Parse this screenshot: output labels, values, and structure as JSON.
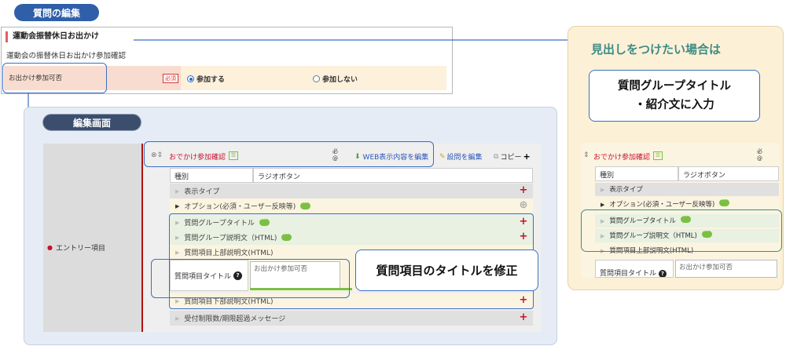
{
  "top_pill": "質問の編集",
  "preview": {
    "title": "運動会振替休日お出かけ",
    "subtitle": "運動会の振替休日お出かけ参加確認",
    "question_label": "お出かけ参加可否",
    "required_badge": "必須",
    "option_yes": "参加する",
    "option_no": "参加しない"
  },
  "edit_pill": "編集画面",
  "entry_label": "エントリー項目",
  "editor": {
    "question_name": "おでかけ参加確認",
    "at_badge_1": "必",
    "at_badge_2": "@",
    "web_edit": "WEB表示内容を編集",
    "setting_edit": "設問を編集",
    "copy": "コピー",
    "type_label": "種別",
    "type_value": "ラジオボタン",
    "rows": {
      "display_type": "表示タイプ",
      "options": "オプション(必須・ユーザー反映等)",
      "group_title": "質問グループタイトル",
      "group_desc": "質問グループ説明文（HTML)",
      "item_top_desc": "質問項目上部説明文(HTML)",
      "item_title_label": "質問項目タイトル",
      "item_title_value": "お出かけ参加可否",
      "item_bottom_desc": "質問項目下部説明文(HTML)",
      "limit_msg": "受付制限数/期限超過メッセージ"
    }
  },
  "callout_fix": "質問項目のタイトルを修正",
  "right": {
    "heading": "見出しをつけたい場合は",
    "callout_line1": "質問グループタイトル",
    "callout_line2": "・紹介文に入力",
    "question_name": "おでかけ参加確認",
    "type_label": "種別",
    "type_value": "ラジオボタン",
    "display_type": "表示タイプ",
    "options": "オプション(必須・ユーザー反映等)",
    "group_title": "質問グループタイトル",
    "group_desc": "質問グループ説明文（HTML)",
    "item_top_desc": "質問項目上部説明文(HTML)",
    "item_title_label": "質問項目タイトル",
    "item_title_value": "お出かけ参加可否"
  },
  "colors": {
    "blue": "#2f5fa8",
    "highlight": "#3b6fc4",
    "teal": "#3d8c86",
    "accent_red": "#c8102e",
    "green": "#7bc043"
  }
}
